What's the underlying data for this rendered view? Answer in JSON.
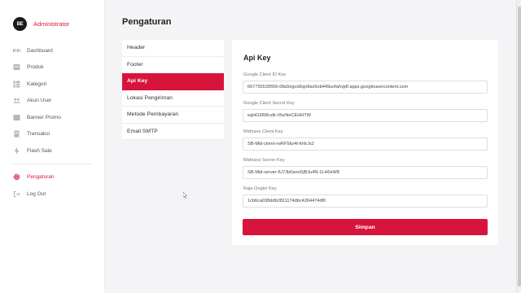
{
  "brand": {
    "logo_text": "BE",
    "name": "Administrator"
  },
  "sidebar": {
    "items": [
      {
        "label": "Dashboard",
        "icon": "dashboard-icon"
      },
      {
        "label": "Produk",
        "icon": "product-icon"
      },
      {
        "label": "Kategori",
        "icon": "category-icon"
      },
      {
        "label": "Akun User",
        "icon": "users-icon"
      },
      {
        "label": "Banner Promo",
        "icon": "banner-icon"
      },
      {
        "label": "Transaksi",
        "icon": "transaction-icon"
      },
      {
        "label": "Flash Sale",
        "icon": "flash-icon"
      }
    ],
    "bottom_items": [
      {
        "label": "Pengaturan",
        "icon": "gear-icon",
        "active": true
      },
      {
        "label": "Log Out",
        "icon": "logout-icon"
      }
    ]
  },
  "page": {
    "title": "Pengaturan"
  },
  "settings_menu": {
    "items": [
      {
        "label": "Header"
      },
      {
        "label": "Footer"
      },
      {
        "label": "Api Key",
        "active": true
      },
      {
        "label": "Lokasi Pengiriman"
      },
      {
        "label": "Metode Pembayaran"
      },
      {
        "label": "Email SMTP"
      }
    ]
  },
  "api_key": {
    "title": "Api Key",
    "fields": [
      {
        "label": "Google Client ID Key",
        "value": "667755539556-t9la5rigvs8sjn8av5ob449uofahvjdf.apps.googleusercontent.com"
      },
      {
        "label": "Google Client Secret Key",
        "value": "egHG6l58czlk-VbzNeCEHHTW"
      },
      {
        "label": "Midtrans Client Key",
        "value": "SB-Mid-client-rwRF5kz4t-khIrJs2"
      },
      {
        "label": "Midtrans Server Key",
        "value": "SB-Mid-server-IU7Jb0aovDjBJu4N-1LH0sW8"
      },
      {
        "label": "Raja Ongkir Key",
        "value": "1cb6ca038ddb2811174dbc4264474df0"
      }
    ],
    "save_label": "Simpan"
  },
  "colors": {
    "accent": "#d7143c",
    "background": "#f4f4f6",
    "panel": "#ffffff"
  }
}
